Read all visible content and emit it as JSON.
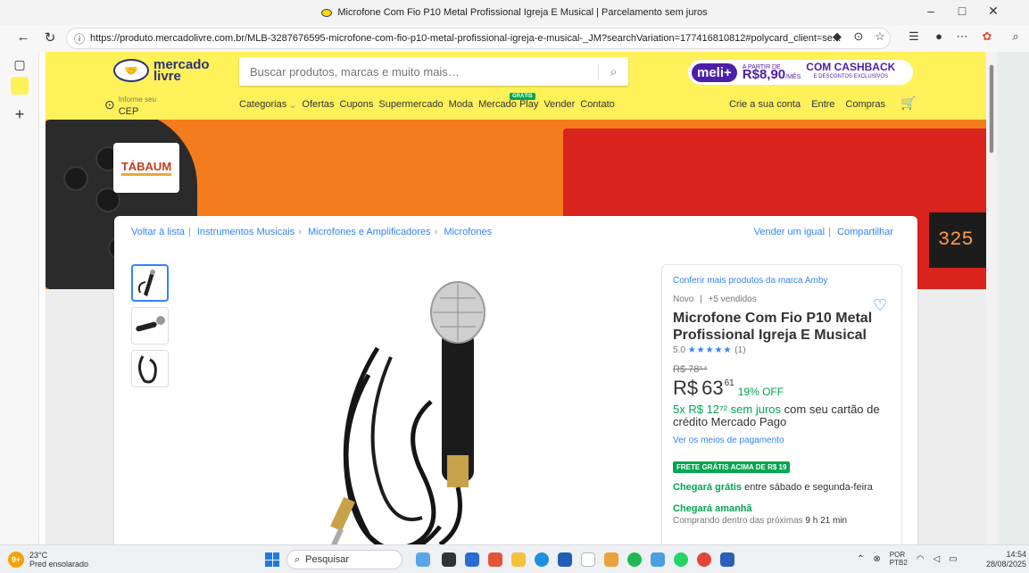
{
  "window": {
    "title": "Microfone Com Fio P10 Metal Profissional Igreja E Musical | Parcelamento sem juros",
    "controls": [
      "–",
      "□",
      "✕"
    ]
  },
  "browser": {
    "url": "https://produto.mercadolivre.com.br/MLB-3287676595-microfone-com-fio-p10-metal-profissional-igreja-e-musical-_JM?searchVariation=177416810812#polycard_client=se...",
    "nav": {
      "back": "←",
      "reload": "↻"
    }
  },
  "header": {
    "logo_line1": "mercado",
    "logo_line2": "livre",
    "search_placeholder": "Buscar produtos, marcas e muito mais…",
    "meli": {
      "brand": "meli+",
      "from_label": "A PARTIR DE",
      "price": "R$8,90",
      "per": "/MÊS",
      "cashback": "COM CASHBACK",
      "cashback_sub": "E DESCONTOS EXCLUSIVOS"
    },
    "cep": {
      "label": "Informe seu",
      "value": "CEP"
    },
    "menu": [
      "Categorias",
      "Ofertas",
      "Cupons",
      "Supermercado",
      "Moda",
      "Mercado Play",
      "Vender",
      "Contato"
    ],
    "gratis_badge": "GRÁTIS",
    "account": [
      "Crie a sua conta",
      "Entre",
      "Compras"
    ]
  },
  "banner": {
    "brand": "TÁBAUM",
    "display": "325"
  },
  "product": {
    "breadcrumbs": {
      "back": "Voltar à lista",
      "path": [
        "Instrumentos Musicais",
        "Microfones e Amplificadores",
        "Microfones"
      ]
    },
    "actions": [
      "Vender um igual",
      "Compartilhar"
    ],
    "brand_link": "Conferir mais produtos da marca Amby",
    "condition": "Novo",
    "sold": "+5 vendidos",
    "title": "Microfone Com Fio P10 Metal Profissional Igreja E Musical",
    "rating": {
      "score": "5.0",
      "stars": "★★★★★",
      "count": "(1)"
    },
    "old_price": "R$ 78⁵⁴",
    "price": {
      "currency": "R$",
      "integer": "63",
      "cents": "61",
      "discount": "19% OFF"
    },
    "installments": {
      "highlight": "5x R$ 12⁷² sem juros",
      "rest": "com seu cartão de crédito Mercado Pago"
    },
    "payment_link": "Ver os meios de pagamento",
    "shipping_badge": "FRETE GRÁTIS ACIMA DE R$ 19",
    "arrival": {
      "highlight": "Chegará grátis",
      "rest": "entre sábado e segunda-feira"
    },
    "tomorrow": "Chegará amanhã",
    "within": {
      "prefix": "Comprando dentro das próximas",
      "time": "9 h 21 min"
    }
  },
  "taskbar": {
    "weather": {
      "temp": "23°C",
      "desc": "Pred ensolarado",
      "badge": "9+"
    },
    "search_label": "Pesquisar",
    "lang": [
      "POR",
      "PTB2"
    ],
    "time": "14:54",
    "date": "28/08/2025",
    "colors": {
      "start": "#1f7ae0",
      "ml_yellow": "#fff159",
      "ml_blue": "#3483fa",
      "green": "#00a650"
    }
  }
}
